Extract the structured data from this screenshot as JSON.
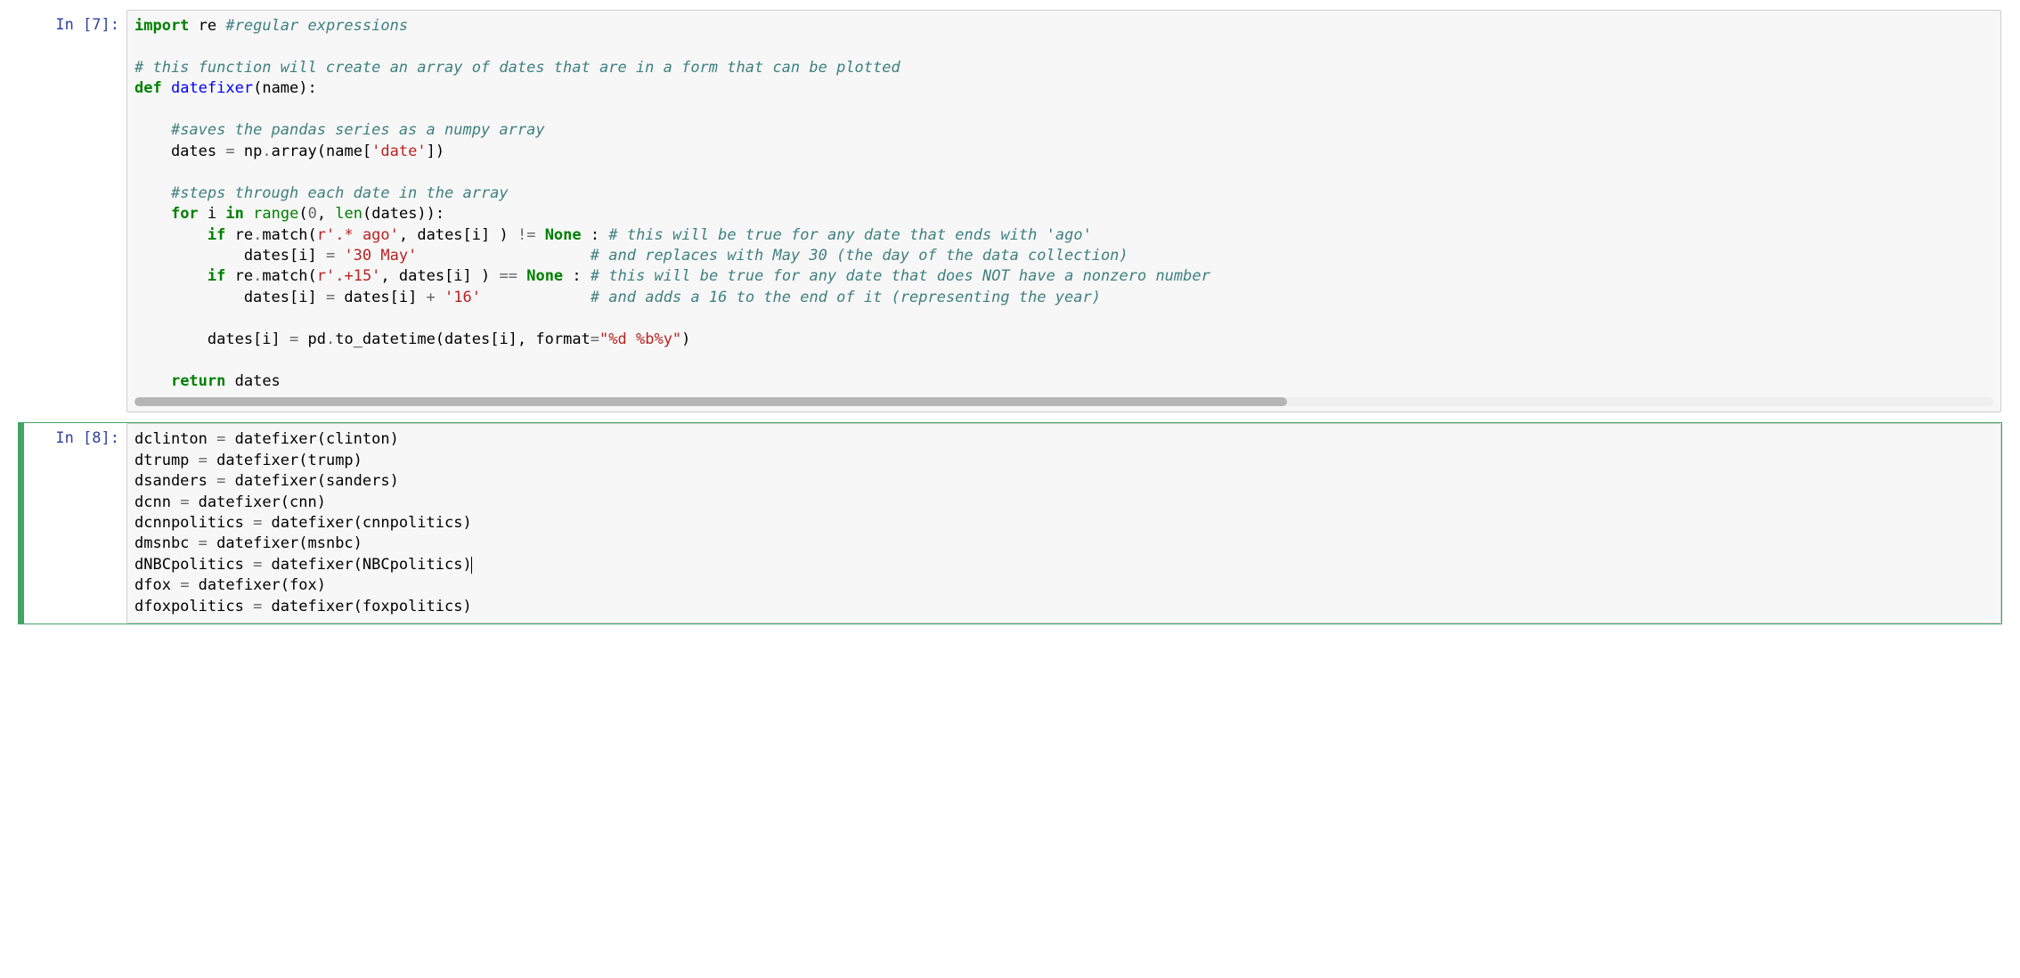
{
  "cells": [
    {
      "prompt": "In [7]:",
      "selected": false,
      "has_hscroll": true,
      "code_html": "<span class=\"kw\">import</span> re <span class=\"cm\">#regular expressions</span>\n\n<span class=\"cm\"># this function will create an array of dates that are in a form that can be plotted</span>\n<span class=\"kw\">def</span> <span class=\"nf\">datefixer</span>(name):\n    \n    <span class=\"cm\">#saves the pandas series as a numpy array</span>\n    dates <span class=\"op\">=</span> np<span class=\"op\">.</span>array(name[<span class=\"st\">'date'</span>])\n    \n    <span class=\"cm\">#steps through each date in the array</span>\n    <span class=\"kw\">for</span> i <span class=\"kw\">in</span> <span class=\"nb\">range</span>(<span class=\"num\">0</span>, <span class=\"nb\">len</span>(dates)):\n        <span class=\"kw\">if</span> re<span class=\"op\">.</span>match(<span class=\"st\">r'.* ago'</span>, dates[i] ) <span class=\"op\">!=</span> <span class=\"kw\">None</span> : <span class=\"cm\"># this will be true for any date that ends with 'ago'</span>\n            dates[i] <span class=\"op\">=</span> <span class=\"st\">'30 May'</span>                   <span class=\"cm\"># and replaces with May 30 (the day of the data collection)</span>\n        <span class=\"kw\">if</span> re<span class=\"op\">.</span>match(<span class=\"st\">r'.+15'</span>, dates[i] ) <span class=\"op\">==</span> <span class=\"kw\">None</span> : <span class=\"cm\"># this will be true for any date that does NOT have a nonzero number </span>\n            dates[i] <span class=\"op\">=</span> dates[i] <span class=\"op\">+</span> <span class=\"st\">'16'</span>            <span class=\"cm\"># and adds a 16 to the end of it (representing the year)</span>\n            \n        dates[i] <span class=\"op\">=</span> pd<span class=\"op\">.</span>to_datetime(dates[i], format<span class=\"op\">=</span><span class=\"st\">\"%d %b%y\"</span>)\n        \n    <span class=\"kw\">return</span> dates",
      "code_plain": "import re #regular expressions\n\n# this function will create an array of dates that are in a form that can be plotted\ndef datefixer(name):\n    \n    #saves the pandas series as a numpy array\n    dates = np.array(name['date'])\n    \n    #steps through each date in the array\n    for i in range(0, len(dates)):\n        if re.match(r'.* ago', dates[i] ) != None : # this will be true for any date that ends with 'ago'\n            dates[i] = '30 May'                   # and replaces with May 30 (the day of the data collection)\n        if re.match(r'.+15', dates[i] ) == None : # this will be true for any date that does NOT have a nonzero number \n            dates[i] = dates[i] + '16'            # and adds a 16 to the end of it (representing the year)\n            \n        dates[i] = pd.to_datetime(dates[i], format=\"%d %b%y\")\n        \n    return dates"
    },
    {
      "prompt": "In [8]:",
      "selected": true,
      "has_hscroll": false,
      "code_html": "dclinton <span class=\"op\">=</span> datefixer(clinton)\ndtrump <span class=\"op\">=</span> datefixer(trump)\ndsanders <span class=\"op\">=</span> datefixer(sanders)\ndcnn <span class=\"op\">=</span> datefixer(cnn)\ndcnnpolitics <span class=\"op\">=</span> datefixer(cnnpolitics)\ndmsnbc <span class=\"op\">=</span> datefixer(msnbc)\ndNBCpolitics <span class=\"op\">=</span> datefixer(NBCpolitics)<span class=\"cursor\"></span>\ndfox <span class=\"op\">=</span> datefixer(fox)\ndfoxpolitics <span class=\"op\">=</span> datefixer(foxpolitics)",
      "code_plain": "dclinton = datefixer(clinton)\ndtrump = datefixer(trump)\ndsanders = datefixer(sanders)\ndcnn = datefixer(cnn)\ndcnnpolitics = datefixer(cnnpolitics)\ndmsnbc = datefixer(msnbc)\ndNBCpolitics = datefixer(NBCpolitics)\ndfox = datefixer(fox)\ndfoxpolitics = datefixer(foxpolitics)"
    }
  ]
}
